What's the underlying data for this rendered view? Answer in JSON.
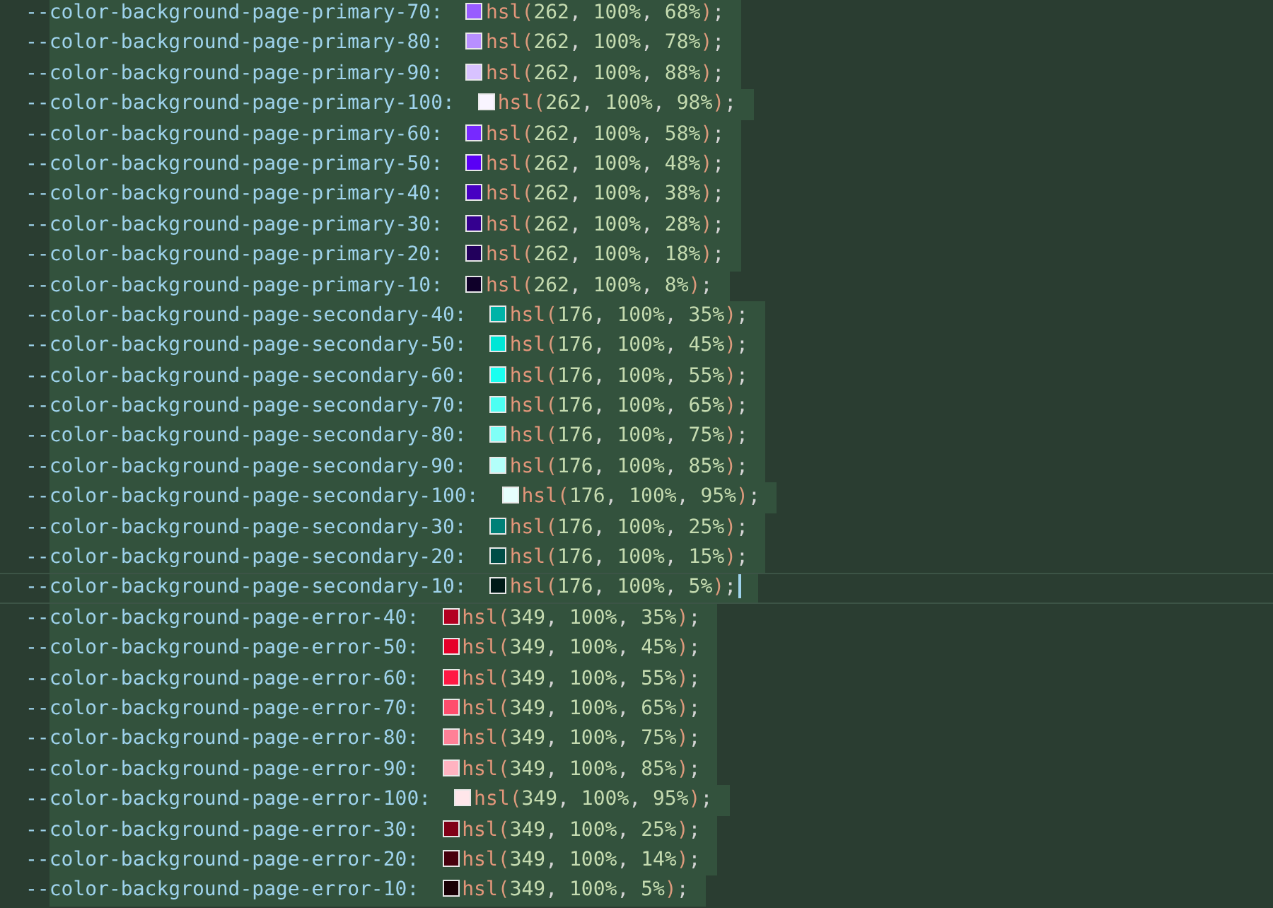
{
  "editor": {
    "lines": [
      {
        "declaration": "--color-background-page-primary-70:",
        "value": "hsl(262, 100%, 68%);",
        "color": "#985cff",
        "current": false
      },
      {
        "declaration": "--color-background-page-primary-80:",
        "value": "hsl(262, 100%, 78%);",
        "color": "#b88fff",
        "current": false
      },
      {
        "declaration": "--color-background-page-primary-90:",
        "value": "hsl(262, 100%, 88%);",
        "color": "#d8c2ff",
        "current": false
      },
      {
        "declaration": "--color-background-page-primary-100:",
        "value": "hsl(262, 100%, 98%);",
        "color": "#f9f5ff",
        "current": false
      },
      {
        "declaration": "--color-background-page-primary-60:",
        "value": "hsl(262, 100%, 58%);",
        "color": "#7729ff",
        "current": false
      },
      {
        "declaration": "--color-background-page-primary-50:",
        "value": "hsl(262, 100%, 48%);",
        "color": "#5a00f5",
        "current": false
      },
      {
        "declaration": "--color-background-page-primary-40:",
        "value": "hsl(262, 100%, 38%);",
        "color": "#4700c2",
        "current": false
      },
      {
        "declaration": "--color-background-page-primary-30:",
        "value": "hsl(262, 100%, 28%);",
        "color": "#34008f",
        "current": false
      },
      {
        "declaration": "--color-background-page-primary-20:",
        "value": "hsl(262, 100%, 18%);",
        "color": "#22005c",
        "current": false
      },
      {
        "declaration": "--color-background-page-primary-10:",
        "value": "hsl(262, 100%, 8%);",
        "color": "#0f0029",
        "current": false
      },
      {
        "declaration": "--color-background-page-secondary-40:",
        "value": "hsl(176, 100%, 35%);",
        "color": "#00b3a7",
        "current": false
      },
      {
        "declaration": "--color-background-page-secondary-50:",
        "value": "hsl(176, 100%, 45%);",
        "color": "#00e6d6",
        "current": false
      },
      {
        "declaration": "--color-background-page-secondary-60:",
        "value": "hsl(176, 100%, 55%);",
        "color": "#1afff0",
        "current": false
      },
      {
        "declaration": "--color-background-page-secondary-70:",
        "value": "hsl(176, 100%, 65%);",
        "color": "#4dfff3",
        "current": false
      },
      {
        "declaration": "--color-background-page-secondary-80:",
        "value": "hsl(176, 100%, 75%);",
        "color": "#80fff7",
        "current": false
      },
      {
        "declaration": "--color-background-page-secondary-90:",
        "value": "hsl(176, 100%, 85%);",
        "color": "#b3fffa",
        "current": false
      },
      {
        "declaration": "--color-background-page-secondary-100:",
        "value": "hsl(176, 100%, 95%);",
        "color": "#e6fffd",
        "current": false
      },
      {
        "declaration": "--color-background-page-secondary-30:",
        "value": "hsl(176, 100%, 25%);",
        "color": "#008077",
        "current": false
      },
      {
        "declaration": "--color-background-page-secondary-20:",
        "value": "hsl(176, 100%, 15%);",
        "color": "#004d47",
        "current": false
      },
      {
        "declaration": "--color-background-page-secondary-10:",
        "value": "hsl(176, 100%, 5%);",
        "color": "#001a18",
        "current": true
      },
      {
        "declaration": "--color-background-page-error-40:",
        "value": "hsl(349, 100%, 35%);",
        "color": "#b30021",
        "current": false
      },
      {
        "declaration": "--color-background-page-error-50:",
        "value": "hsl(349, 100%, 45%);",
        "color": "#e6002a",
        "current": false
      },
      {
        "declaration": "--color-background-page-error-60:",
        "value": "hsl(349, 100%, 55%);",
        "color": "#ff1a44",
        "current": false
      },
      {
        "declaration": "--color-background-page-error-70:",
        "value": "hsl(349, 100%, 65%);",
        "color": "#ff4d6d",
        "current": false
      },
      {
        "declaration": "--color-background-page-error-80:",
        "value": "hsl(349, 100%, 75%);",
        "color": "#ff8097",
        "current": false
      },
      {
        "declaration": "--color-background-page-error-90:",
        "value": "hsl(349, 100%, 85%);",
        "color": "#ffb3c1",
        "current": false
      },
      {
        "declaration": "--color-background-page-error-100:",
        "value": "hsl(349, 100%, 95%);",
        "color": "#ffe6ea",
        "current": false
      },
      {
        "declaration": "--color-background-page-error-30:",
        "value": "hsl(349, 100%, 25%);",
        "color": "#800017",
        "current": false
      },
      {
        "declaration": "--color-background-page-error-20:",
        "value": "hsl(349, 100%, 14%);",
        "color": "#47000d",
        "current": false
      },
      {
        "declaration": "--color-background-page-error-10:",
        "value": "hsl(349, 100%, 5%);",
        "color": "#1a0005",
        "current": false
      }
    ]
  }
}
